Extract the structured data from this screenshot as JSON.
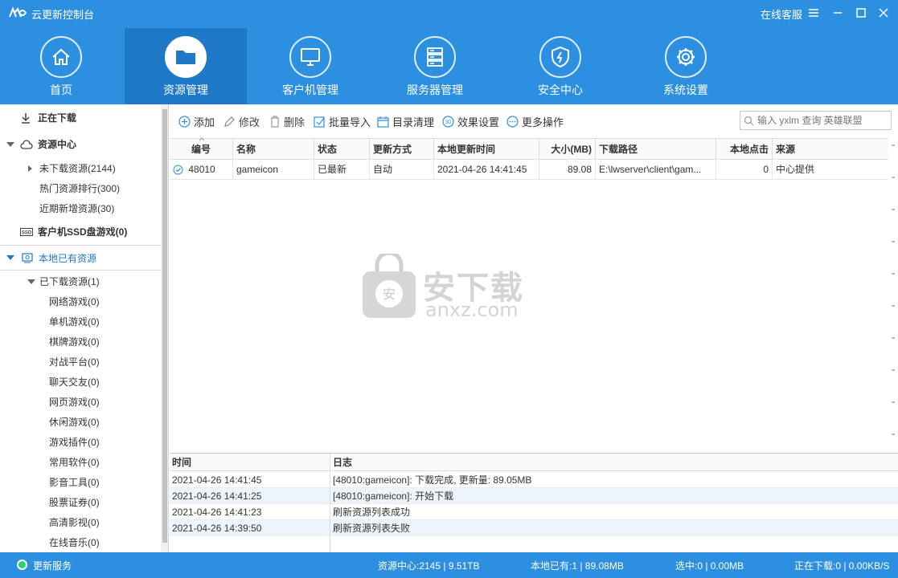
{
  "window": {
    "title": "云更新控制台",
    "online_service": "在线客服"
  },
  "nav": [
    {
      "label": "首页",
      "icon": "home-icon"
    },
    {
      "label": "资源管理",
      "icon": "folder-icon",
      "active": true
    },
    {
      "label": "客户机管理",
      "icon": "monitor-icon"
    },
    {
      "label": "服务器管理",
      "icon": "server-icon"
    },
    {
      "label": "安全中心",
      "icon": "shield-icon"
    },
    {
      "label": "系统设置",
      "icon": "gear-icon"
    }
  ],
  "sidebar": {
    "downloading": "正在下载",
    "resource_center": "资源中心",
    "not_downloaded": "未下载资源(2144)",
    "hot_ranking": "热门资源排行(300)",
    "recent_new": "近期新增资源(30)",
    "ssd_games": "客户机SSD盘游戏(0)",
    "local_resources": "本地已有资源",
    "downloaded": "已下载资源(1)",
    "categories": [
      "网络游戏(0)",
      "单机游戏(0)",
      "棋牌游戏(0)",
      "对战平台(0)",
      "聊天交友(0)",
      "网页游戏(0)",
      "休闲游戏(0)",
      "游戏插件(0)",
      "常用软件(0)",
      "影音工具(0)",
      "股票证券(0)",
      "高清影视(0)",
      "在线音乐(0)"
    ]
  },
  "toolbar": {
    "add": "添加",
    "edit": "修改",
    "delete": "删除",
    "batch_import": "批量导入",
    "dir_clean": "目录清理",
    "effect_settings": "效果设置",
    "more": "更多操作",
    "search_placeholder": "输入 yxlm 查询 英雄联盟"
  },
  "table": {
    "headers": [
      "编号",
      "名称",
      "状态",
      "更新方式",
      "本地更新时间",
      "大小(MB)",
      "下载路径",
      "本地点击",
      "来源"
    ],
    "rows": [
      {
        "id": "48010",
        "name": "gameicon",
        "status": "已最新",
        "update_mode": "自动",
        "local_update_time": "2021-04-26 14:41:45",
        "size": "89.08",
        "path": "E:\\lwserver\\client\\gam...",
        "clicks": "0",
        "source": "中心提供"
      }
    ]
  },
  "log": {
    "headers": [
      "时间",
      "日志"
    ],
    "rows": [
      {
        "time": "2021-04-26 14:41:45",
        "msg": "[48010:gameicon]: 下载完成, 更新量: 89.05MB"
      },
      {
        "time": "2021-04-26 14:41:25",
        "msg": "[48010:gameicon]: 开始下载"
      },
      {
        "time": "2021-04-26 14:41:23",
        "msg": "刷新资源列表成功"
      },
      {
        "time": "2021-04-26 14:39:50",
        "msg": "刷新资源列表失败"
      }
    ]
  },
  "status": {
    "service": "更新服务",
    "center": "资源中心:2145 | 9.51TB",
    "local": "本地已有:1 | 89.08MB",
    "selected": "选中:0 | 0.00MB",
    "downloading": "正在下载:0 | 0.00KB/S"
  },
  "watermark": {
    "text_cn": "安下载",
    "text_en": "anxz.com",
    "badge": "安"
  },
  "colors": {
    "primary": "#2c8fe0",
    "primary_dark": "#1e79c8",
    "status_dot": "#29d16a"
  }
}
